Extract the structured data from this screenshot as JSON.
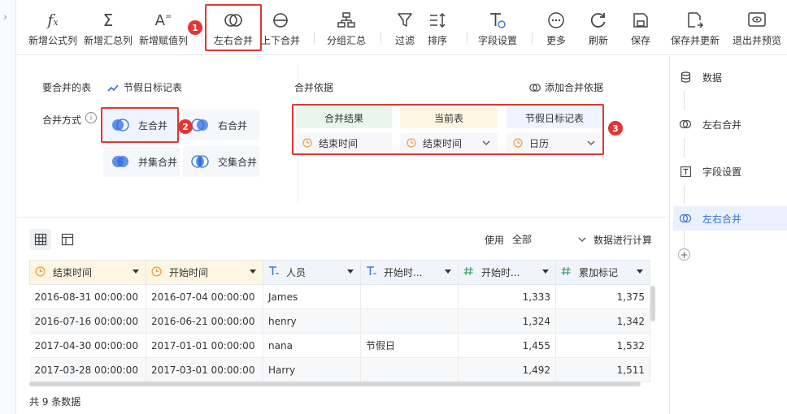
{
  "toolbar": {
    "items": [
      {
        "label": "新增公式列",
        "icon": "fx-icon"
      },
      {
        "label": "新增汇总列",
        "icon": "sigma-icon"
      },
      {
        "label": "新增赋值列",
        "icon": "assign-icon"
      },
      {
        "label": "左右合并",
        "icon": "left-right-merge-icon"
      },
      {
        "label": "上下合并",
        "icon": "up-down-merge-icon"
      },
      {
        "label": "分组汇总",
        "icon": "group-summary-icon"
      },
      {
        "label": "过滤",
        "icon": "filter-icon"
      },
      {
        "label": "排序",
        "icon": "sort-icon"
      },
      {
        "label": "字段设置",
        "icon": "field-settings-icon"
      },
      {
        "label": "更多",
        "icon": "more-icon"
      },
      {
        "label": "刷新",
        "icon": "refresh-icon"
      },
      {
        "label": "保存",
        "icon": "save-icon"
      },
      {
        "label": "保存并更新",
        "icon": "save-update-icon"
      },
      {
        "label": "退出并预览",
        "icon": "exit-preview-icon"
      }
    ]
  },
  "badges": [
    "1",
    "2",
    "3"
  ],
  "config": {
    "table_label": "要合并的表",
    "table_name": "节假日标记表",
    "mode_label": "合并方式",
    "modes": [
      "左合并",
      "右合并",
      "并集合并",
      "交集合并"
    ],
    "basis_label": "合并依据",
    "add_basis": "添加合并依据",
    "headers": [
      "合并结果",
      "当前表",
      "节假日标记表"
    ],
    "fields": [
      "结束时间",
      "结束时间",
      "日历"
    ]
  },
  "table_controls": {
    "use_label": "使用",
    "use_value": "全部",
    "calc_label": "数据进行计算"
  },
  "table": {
    "columns": [
      {
        "label": "结束时间",
        "type": "date"
      },
      {
        "label": "开始时间",
        "type": "date"
      },
      {
        "label": "人员",
        "type": "text"
      },
      {
        "label": "开始时...",
        "type": "text"
      },
      {
        "label": "开始时...",
        "type": "number"
      },
      {
        "label": "累加标记",
        "type": "number"
      }
    ],
    "rows": [
      [
        "2016-08-31 00:00:00",
        "2016-07-04 00:00:00",
        "James",
        "",
        "1,333",
        "1,375"
      ],
      [
        "2016-07-16 00:00:00",
        "2016-06-21 00:00:00",
        "henry",
        "",
        "1,324",
        "1,342"
      ],
      [
        "2017-04-30 00:00:00",
        "2017-01-01 00:00:00",
        "nana",
        "节假日",
        "1,455",
        "1,532"
      ],
      [
        "2017-03-28 00:00:00",
        "2017-03-01 00:00:00",
        "Harry",
        "",
        "1,492",
        "1,511"
      ]
    ]
  },
  "footer": "共 9 条数据",
  "steps": [
    {
      "label": "数据",
      "icon": "database-icon"
    },
    {
      "label": "左右合并",
      "icon": "left-right-merge-icon"
    },
    {
      "label": "字段设置",
      "icon": "field-settings-icon"
    },
    {
      "label": "左右合并",
      "icon": "left-right-merge-icon"
    }
  ],
  "colors": {
    "accent": "#2f6fe0",
    "highlight": "#e23535",
    "date_icon": "#f0a030",
    "type_icon": "#3a7bd5",
    "num_icon": "#3fa66c"
  }
}
